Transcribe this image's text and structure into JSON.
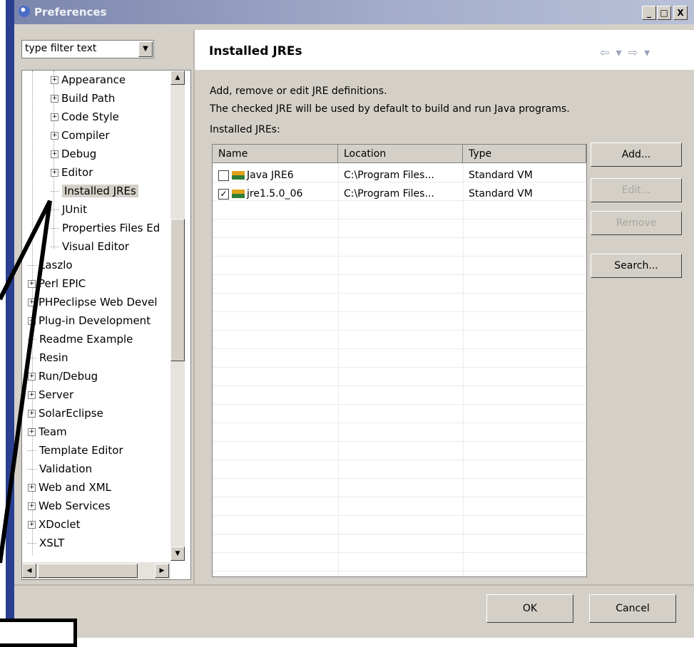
{
  "window": {
    "title": "Preferences",
    "controls": [
      "_",
      "□",
      "X"
    ]
  },
  "filter": {
    "value": "type filter text"
  },
  "tree": {
    "items": [
      {
        "label": "Appearance",
        "expandable": true,
        "level": 2
      },
      {
        "label": "Build Path",
        "expandable": true,
        "level": 2
      },
      {
        "label": "Code Style",
        "expandable": true,
        "level": 2
      },
      {
        "label": "Compiler",
        "expandable": true,
        "level": 2
      },
      {
        "label": "Debug",
        "expandable": true,
        "level": 2
      },
      {
        "label": "Editor",
        "expandable": true,
        "level": 2
      },
      {
        "label": "Installed JREs",
        "expandable": false,
        "level": 2,
        "selected": true
      },
      {
        "label": "JUnit",
        "expandable": false,
        "level": 2
      },
      {
        "label": "Properties Files Ed",
        "expandable": false,
        "level": 2
      },
      {
        "label": "Visual Editor",
        "expandable": false,
        "level": 2
      },
      {
        "label": "Laszlo",
        "expandable": false,
        "level": 1
      },
      {
        "label": "Perl EPIC",
        "expandable": true,
        "level": 1
      },
      {
        "label": "PHPeclipse Web Devel",
        "expandable": true,
        "level": 1
      },
      {
        "label": "Plug-in Development",
        "expandable": true,
        "level": 1
      },
      {
        "label": "Readme Example",
        "expandable": false,
        "level": 1
      },
      {
        "label": "Resin",
        "expandable": false,
        "level": 1
      },
      {
        "label": "Run/Debug",
        "expandable": true,
        "level": 1
      },
      {
        "label": "Server",
        "expandable": true,
        "level": 1
      },
      {
        "label": "SolarEclipse",
        "expandable": true,
        "level": 1
      },
      {
        "label": "Team",
        "expandable": true,
        "level": 1
      },
      {
        "label": "Template Editor",
        "expandable": false,
        "level": 1
      },
      {
        "label": "Validation",
        "expandable": false,
        "level": 1
      },
      {
        "label": "Web and XML",
        "expandable": true,
        "level": 1
      },
      {
        "label": "Web Services",
        "expandable": true,
        "level": 1
      },
      {
        "label": "XDoclet",
        "expandable": true,
        "level": 1
      },
      {
        "label": "XSLT",
        "expandable": false,
        "level": 1
      }
    ]
  },
  "page": {
    "title": "Installed JREs",
    "description_line1": "Add, remove or edit JRE definitions.",
    "description_line2": "The checked JRE will be used by default to build and run Java programs.",
    "list_label": "Installed JREs:",
    "nav_arrows": "⇦ ▾ ⇨ ▾"
  },
  "jre_table": {
    "columns": [
      "Name",
      "Location",
      "Type"
    ],
    "rows": [
      {
        "checked": false,
        "name": "Java JRE6",
        "location": "C:\\Program Files...",
        "type": "Standard VM"
      },
      {
        "checked": true,
        "name": "jre1.5.0_06",
        "location": "C:\\Program Files...",
        "type": "Standard VM"
      }
    ]
  },
  "buttons": {
    "add": "Add...",
    "edit": "Edit...",
    "remove": "Remove",
    "search": "Search...",
    "ok": "OK",
    "cancel": "Cancel"
  },
  "icons": {
    "window": "eclipse-icon",
    "jre": "jre-icon",
    "checkbox_checked": "✓",
    "expand": "+",
    "scroll_up": "▲",
    "scroll_down": "▼",
    "scroll_left": "◀",
    "scroll_right": "▶",
    "dropdown": "▼"
  },
  "colors": {
    "dialog_bg": "#d4d0c8",
    "titlebar": "#a3acc9",
    "slide_bar": "#2a3f8f"
  }
}
